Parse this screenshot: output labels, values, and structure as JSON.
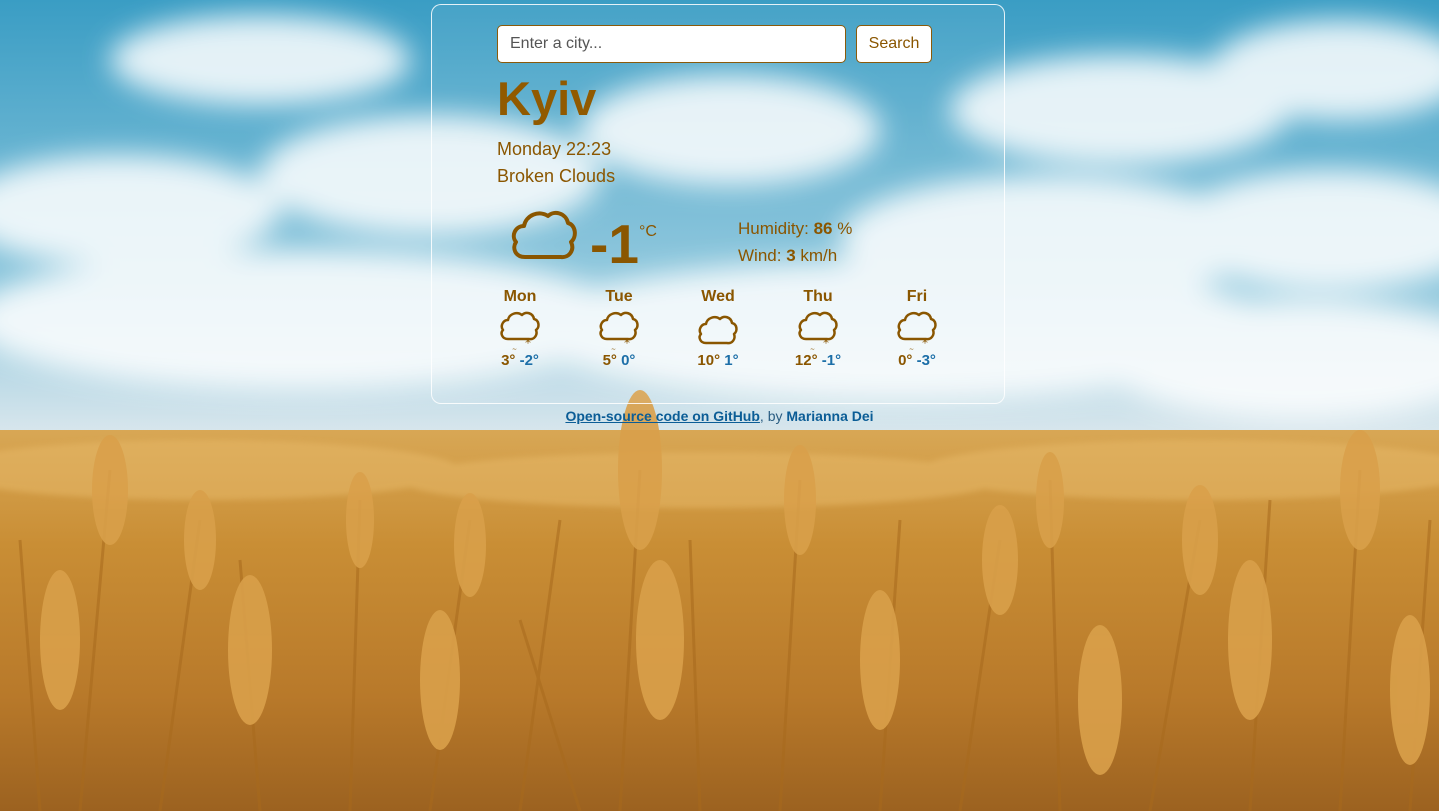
{
  "search": {
    "placeholder": "Enter a city...",
    "button_label": "Search"
  },
  "current": {
    "city": "Kyiv",
    "datetime": "Monday 22:23",
    "description": "Broken Clouds",
    "icon": "cloud-icon",
    "temperature": "-1",
    "unit": "°C",
    "humidity_label": "Humidity: ",
    "humidity_value": "86",
    "humidity_unit": " %",
    "wind_label": "Wind: ",
    "wind_value": "3",
    "wind_unit": " km/h"
  },
  "forecast": [
    {
      "day": "Mon",
      "icon": "snow-cloud-icon",
      "max": "3°",
      "min": "-2°"
    },
    {
      "day": "Tue",
      "icon": "snow-cloud-icon",
      "max": "5°",
      "min": "0°"
    },
    {
      "day": "Wed",
      "icon": "cloud-icon",
      "max": "10°",
      "min": "1°"
    },
    {
      "day": "Thu",
      "icon": "snow-cloud-icon",
      "max": "12°",
      "min": "-1°"
    },
    {
      "day": "Fri",
      "icon": "snow-cloud-icon",
      "max": "0°",
      "min": "-3°"
    }
  ],
  "footer": {
    "link_text": "Open-source code on GitHub",
    "separator": ", by ",
    "author": "Marianna Dei"
  },
  "colors": {
    "accent": "#8a5600",
    "min_temp": "#1d6fa8",
    "link": "#0b5d96"
  }
}
